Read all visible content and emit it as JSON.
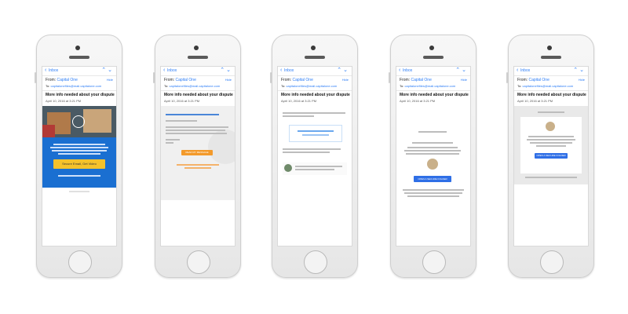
{
  "email": {
    "inbox_label": "Inbox",
    "from_label": "From:",
    "from_name": "Capital One",
    "hide_label": "Hide",
    "to_label": "To:",
    "to_address": "capitalonefiles@mail.capitalone.com",
    "subject": "More info needed about your dispute",
    "date": "April 10, 2016 at 3:21 PM"
  },
  "phones": [
    {
      "cta": "Secure Email, Get Video"
    },
    {
      "cta": "READ MY MESSAGE"
    },
    {
      "cta": ""
    },
    {
      "cta": "OPEN A SECURE FOLDER"
    },
    {
      "cta": "OPEN A SECURE FOLDER"
    }
  ],
  "colors": {
    "link_blue": "#2b7cf6",
    "bank_blue": "#1a6fd1",
    "cta_yellow": "#f4c22b",
    "cta_orange": "#f39a2b",
    "cta_blue": "#2f6fe6"
  }
}
